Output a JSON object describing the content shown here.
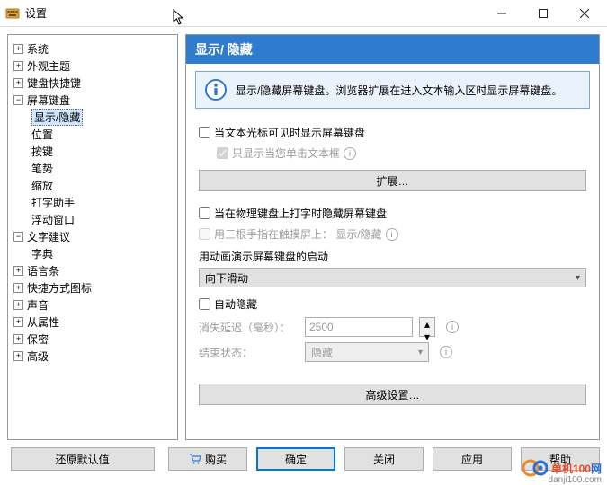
{
  "window": {
    "title": "设置"
  },
  "nav": {
    "items": [
      {
        "label": "系统",
        "depth": 0,
        "expand": false
      },
      {
        "label": "外观主题",
        "depth": 0,
        "expand": false
      },
      {
        "label": "键盘快捷键",
        "depth": 0,
        "expand": false
      },
      {
        "label": "屏幕键盘",
        "depth": 0,
        "expand": true
      },
      {
        "label": "显示/隐藏",
        "depth": 1,
        "selected": true
      },
      {
        "label": "位置",
        "depth": 1
      },
      {
        "label": "按键",
        "depth": 1
      },
      {
        "label": "笔势",
        "depth": 1
      },
      {
        "label": "缩放",
        "depth": 1
      },
      {
        "label": "打字助手",
        "depth": 1
      },
      {
        "label": "浮动窗口",
        "depth": 1
      },
      {
        "label": "文字建议",
        "depth": 0,
        "expand": true
      },
      {
        "label": "字典",
        "depth": 1
      },
      {
        "label": "语言条",
        "depth": 0,
        "expand": false
      },
      {
        "label": "快捷方式图标",
        "depth": 0,
        "expand": false
      },
      {
        "label": "声音",
        "depth": 0,
        "expand": false
      },
      {
        "label": "从属性",
        "depth": 0,
        "expand": false
      },
      {
        "label": "保密",
        "depth": 0,
        "expand": false
      },
      {
        "label": "高级",
        "depth": 0,
        "expand": false
      }
    ]
  },
  "panel": {
    "header": "显示/ 隐藏",
    "info": "显示/隐藏屏幕键盘。浏览器扩展在进入文本输入区时显示屏幕键盘。",
    "cb_caret": "当文本光标可见时显示屏幕键盘",
    "cb_onlyclick": "只显示当您单击文本框",
    "btn_ext": "扩展…",
    "cb_physical": "当在物理键盘上打字时隐藏屏幕键盘",
    "cb_threefinger": "用三根手指在触摸屏上：  显示/隐藏",
    "anim_label": "用动画演示屏幕键盘的启动",
    "anim_value": "向下滑动",
    "cb_autohide": "自动隐藏",
    "delay_label": "消失延迟（毫秒）：",
    "delay_value": "2500",
    "endstate_label": "结束状态：",
    "endstate_value": "隐藏",
    "btn_adv": "高级设置…"
  },
  "buttons": {
    "restore": "还原默认值",
    "buy": "购买",
    "ok": "确定",
    "close": "关闭",
    "apply": "应用",
    "help": "帮助"
  },
  "watermark": {
    "a": "单机100",
    "b": "网",
    "url": "danji100.com"
  }
}
